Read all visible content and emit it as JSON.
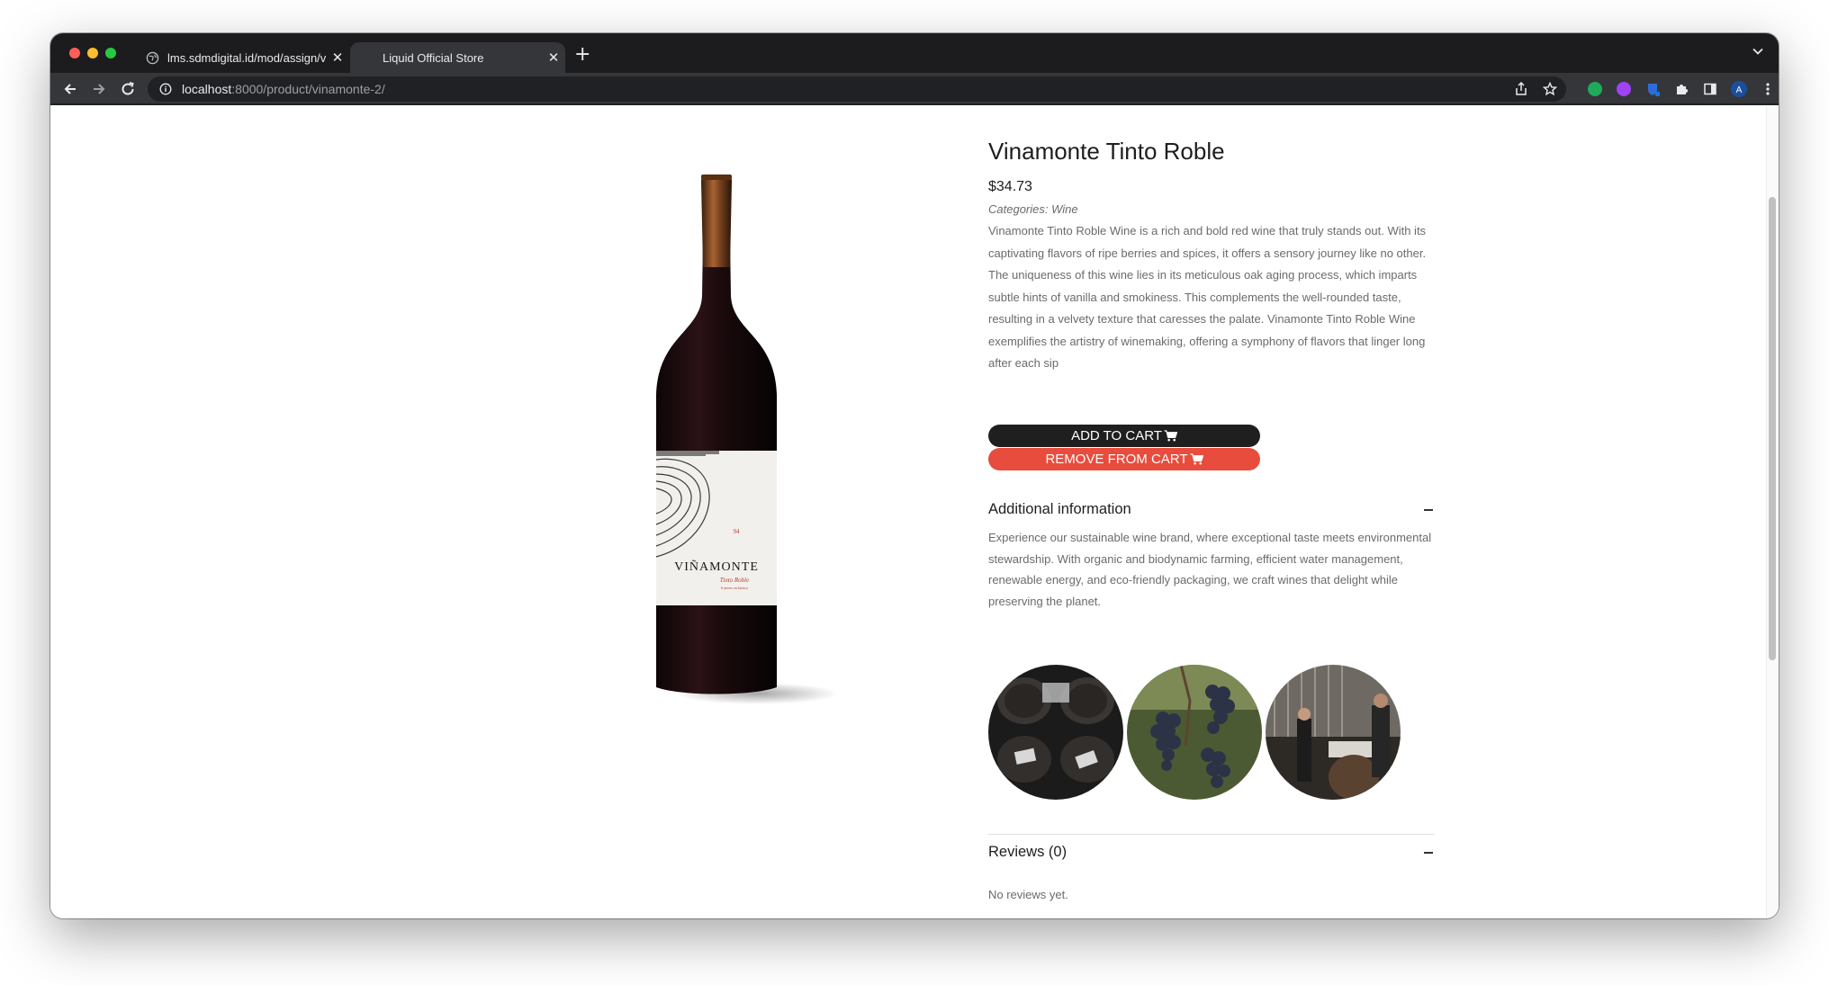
{
  "browser": {
    "tabs": [
      {
        "title": "lms.sdmdigital.id/mod/assign/v",
        "active": false
      },
      {
        "title": "Liquid Official Store",
        "active": true
      }
    ],
    "url_host": "localhost",
    "url_path": ":8000/product/vinamonte-2/"
  },
  "product": {
    "title": "Vinamonte Tinto Roble",
    "price": "$34.73",
    "categories": "Categories: Wine",
    "description": "Vinamonte Tinto Roble Wine is a rich and bold red wine that truly stands out. With its captivating flavors of ripe berries and spices, it offers a sensory journey like no other. The uniqueness of this wine lies in its meticulous oak aging process, which imparts subtle hints of vanilla and smokiness. This complements the well-rounded taste, resulting in a velvety texture that caresses the palate. Vinamonte Tinto Roble Wine exemplifies the artistry of winemaking, offering a symphony of flavors that linger long after each sip",
    "bottle_label": {
      "brand": "VIÑAMONTE",
      "sub": "Tinto Roble",
      "small": "6 meses en barrica",
      "mark": "94"
    }
  },
  "actions": {
    "add_to_cart": "ADD TO CART",
    "remove_from_cart": "REMOVE FROM CART"
  },
  "additional_info": {
    "heading": "Additional information",
    "text": "Experience our sustainable wine brand, where exceptional taste meets environmental stewardship. With organic and biodynamic farming, efficient water management, renewable energy, and eco-friendly packaging, we craft wines that delight while preserving the planet."
  },
  "reviews": {
    "heading": "Reviews (0)",
    "text": "No reviews yet."
  },
  "colors": {
    "add_button": "#1f1f1f",
    "remove_button": "#e84c3d",
    "browser_chrome": "#35363a"
  },
  "icons": [
    "globe-icon",
    "close-icon",
    "plus-icon",
    "chevron-down-icon",
    "back-arrow-icon",
    "forward-arrow-icon",
    "reload-icon",
    "info-icon",
    "share-icon",
    "star-icon",
    "puzzle-icon",
    "sidepanel-icon",
    "profile-avatar-icon",
    "kebab-menu-icon",
    "cart-icon",
    "minus-icon"
  ]
}
